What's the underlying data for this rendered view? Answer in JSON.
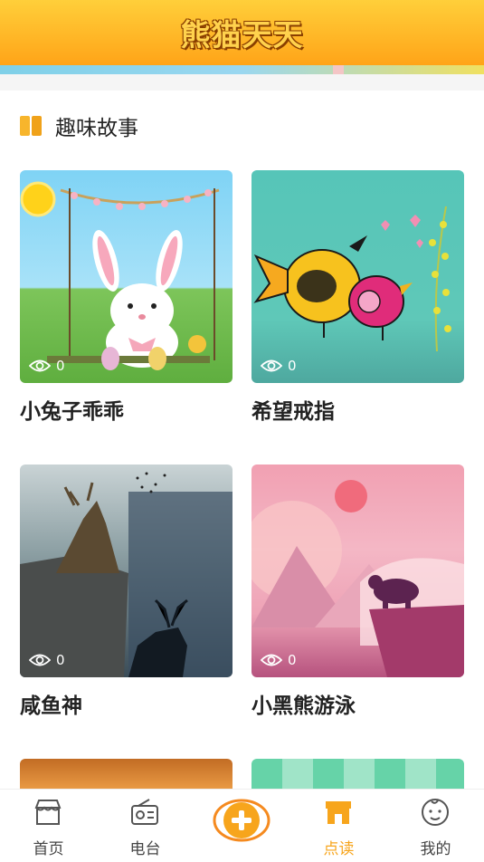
{
  "header": {
    "title": "熊猫天天"
  },
  "section": {
    "title": "趣味故事"
  },
  "stories": [
    {
      "title": "小兔子乖乖",
      "views": "0"
    },
    {
      "title": "希望戒指",
      "views": "0"
    },
    {
      "title": "咸鱼神",
      "views": "0"
    },
    {
      "title": "小黑熊游泳",
      "views": "0"
    }
  ],
  "tabbar": {
    "items": [
      {
        "label": "首页",
        "icon": "storefront-icon"
      },
      {
        "label": "电台",
        "icon": "radio-icon"
      },
      {
        "label": "",
        "icon": "add-center-icon"
      },
      {
        "label": "点读",
        "icon": "shop-icon"
      },
      {
        "label": "我的",
        "icon": "baby-face-icon"
      }
    ],
    "active_color": "#f7a51c"
  }
}
